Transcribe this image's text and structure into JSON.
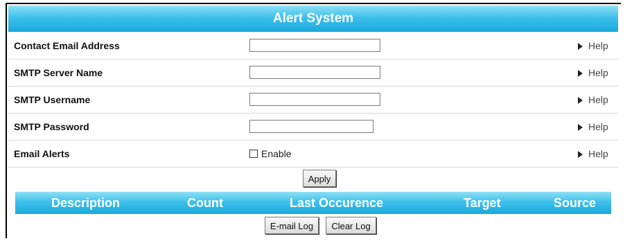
{
  "title": "Alert System",
  "fields": [
    {
      "label": "Contact Email Address",
      "value": ""
    },
    {
      "label": "SMTP Server Name",
      "value": ""
    },
    {
      "label": "SMTP Username",
      "value": ""
    },
    {
      "label": "SMTP Password",
      "value": ""
    }
  ],
  "email_alerts": {
    "label": "Email Alerts",
    "checkbox_label": "Enable",
    "checked": false
  },
  "help_label": "Help",
  "apply_label": "Apply",
  "log_table": {
    "columns": [
      "Description",
      "Count",
      "Last Occurence",
      "Target",
      "Source"
    ]
  },
  "email_log_label": "E-mail Log",
  "clear_log_label": "Clear Log",
  "colors": {
    "header_gradient_top": "#8ee0f5",
    "header_gradient_bottom": "#1aa8dc"
  }
}
